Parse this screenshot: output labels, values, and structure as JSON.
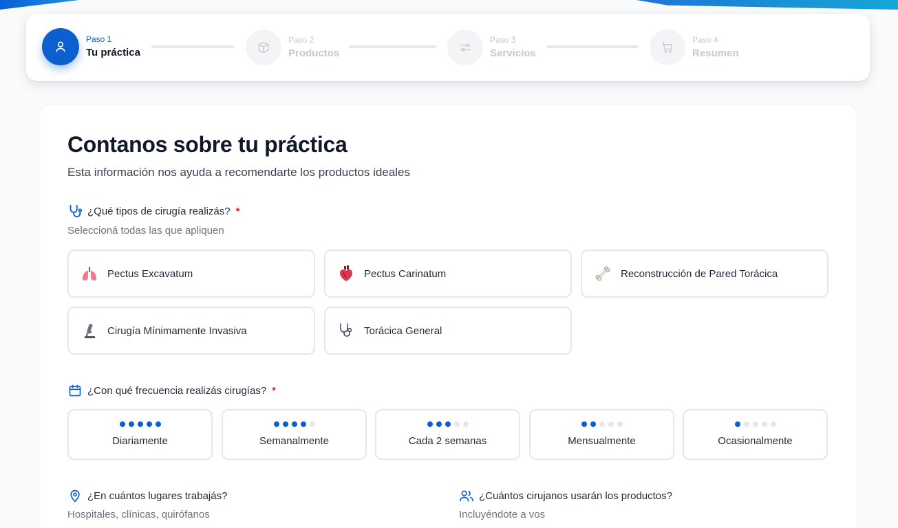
{
  "stepper": {
    "steps": [
      {
        "num": "Paso 1",
        "name": "Tu práctica",
        "icon": "user-icon",
        "active": true
      },
      {
        "num": "Paso 2",
        "name": "Productos",
        "icon": "box-icon",
        "active": false
      },
      {
        "num": "Paso 3",
        "name": "Servicios",
        "icon": "sliders-icon",
        "active": false
      },
      {
        "num": "Paso 4",
        "name": "Resumen",
        "icon": "cart-icon",
        "active": false
      }
    ]
  },
  "form": {
    "title": "Contanos sobre tu práctica",
    "subtitle": "Esta información nos ayuda a recomendarte los productos ideales",
    "surgery": {
      "label": "¿Qué tipos de cirugía realizás?",
      "required": "*",
      "hint": "Seleccioná todas las que apliquen",
      "options": [
        {
          "label": "Pectus Excavatum",
          "icon": "lungs-icon"
        },
        {
          "label": "Pectus Carinatum",
          "icon": "heart-icon"
        },
        {
          "label": "Reconstrucción de Pared Torácica",
          "icon": "bone-icon"
        },
        {
          "label": "Cirugía Mínimamente Invasiva",
          "icon": "microscope-icon"
        },
        {
          "label": "Torácica General",
          "icon": "stethoscope-icon"
        }
      ]
    },
    "frequency": {
      "label": "¿Con qué frecuencia realizás cirugías?",
      "required": "*",
      "options": [
        {
          "label": "Diariamente",
          "level": 5
        },
        {
          "label": "Semanalmente",
          "level": 4
        },
        {
          "label": "Cada 2 semanas",
          "level": 3
        },
        {
          "label": "Mensualmente",
          "level": 2
        },
        {
          "label": "Ocasionalmente",
          "level": 1
        }
      ]
    },
    "places": {
      "label": "¿En cuántos lugares trabajás?",
      "hint": "Hospitales, clínicas, quirófanos"
    },
    "surgeons": {
      "label": "¿Cuántos cirujanos usarán los productos?",
      "hint": "Incluyéndote a vos"
    }
  },
  "colors": {
    "accent": "#0b5fcf",
    "required": "#dc2626",
    "border": "#e5e7eb"
  }
}
